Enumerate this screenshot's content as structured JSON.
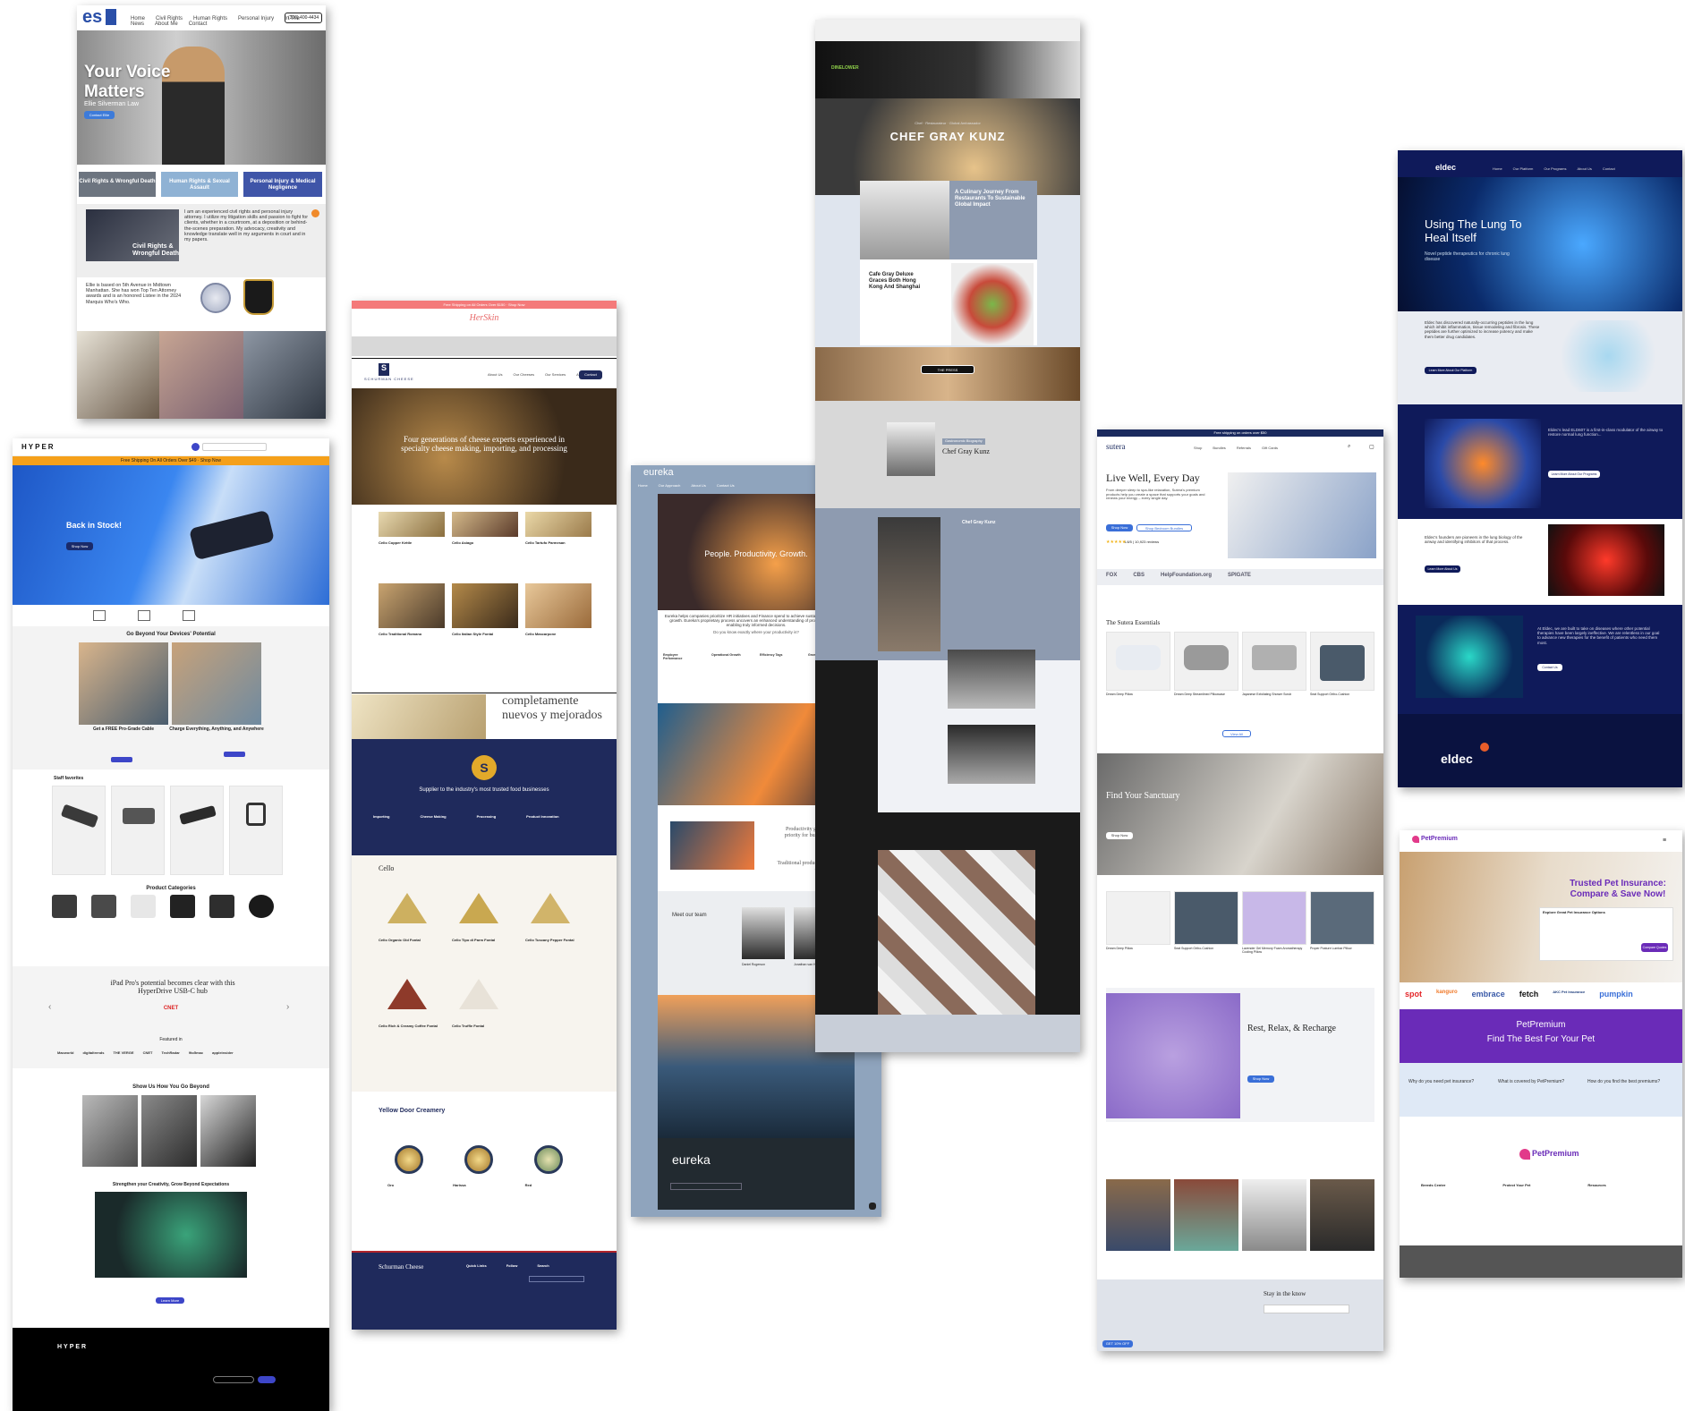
{
  "ellie": {
    "logo": "es",
    "nav": [
      "Home",
      "Civil Rights",
      "Human Rights",
      "Personal Injury",
      "In The News",
      "About Me",
      "Contact"
    ],
    "phone": "(310) 400-4434",
    "hero_title": "Your Voice Matters",
    "hero_sub": "Ellie Silverman Law",
    "hero_cta": "Contact Ellie",
    "tiles": [
      "Civil Rights & Wrongful Death",
      "Human Rights & Sexual Assault",
      "Personal Injury & Medical Negligence"
    ],
    "about_text": "I am an experienced civil rights and personal injury attorney. I utilize my litigation skills and passion to fight for clients, whether in a courtroom, at a deposition or behind-the-scenes preparation. My advocacy, creativity and knowledge translate well in my arguments in court and in my papers.",
    "inset_label": "Civil Rights & Wrongful Death",
    "bio_text": "Ellie is based on 5th Avenue in Midtown Manhattan. She has won Top Ten Attorney awards and is an honored Listee in the 2024 Marquis Who's Who.",
    "colors": {
      "tile1": "#6d7580",
      "tile2": "#8fb2d4",
      "tile3": "#3f55a8"
    }
  },
  "hyper": {
    "logo": "HYPER",
    "banner": "Free Shipping On All Orders Over $49 · Shop Now",
    "hero_title": "Back in Stock!",
    "hero_cta": "Shop Now",
    "section1_title": "Go Beyond Your Devices' Potential",
    "promo1": "Get a FREE Pro-Grade Cable",
    "promo2": "Charge Everything, Anything, and Anywhere",
    "best_sellers": "Staff favorites",
    "categories_title": "Product Categories",
    "categories": [
      "iPad",
      "HyperDrive USB-C Hubs",
      "HyperJuice Power",
      "Accessories",
      "Cables",
      "Bundles"
    ],
    "quote": "iPad Pro's potential becomes clear with this HyperDrive USB-C hub",
    "quote_source": "CNET",
    "featured": "Featured in",
    "press": [
      "Macworld",
      "digitaltrends",
      "THE VERGE",
      "CNET",
      "TechRadar",
      "9to5mac",
      "appleinsider"
    ],
    "show_us": "Show Us How You Go Beyond",
    "strengthen": "Strengthen your Creativity, Grow Beyond Expectations",
    "strengthen_cta": "Learn More",
    "footer_logo": "HYPER",
    "colors": {
      "banner": "#f5a01a",
      "accent": "#3d46c8"
    }
  },
  "cheese": {
    "promo_bar": "Free Shipping on All Orders Over $150 · Shop Now",
    "herskin": "HerSkin",
    "logo": "SCHURMAN CHEESE",
    "nav": [
      "About Us",
      "Our Cheeses",
      "Our Services",
      "About Us",
      "Contact"
    ],
    "nav_cta": "Contact",
    "hero_title": "Four generations of cheese experts experienced in specialty cheese making, importing, and processing",
    "products_row1": [
      "Cello Copper Kettle",
      "Cello Asiago",
      "Cello Tartufo Parmesan"
    ],
    "products_row2": [
      "Cello Traditional Romano",
      "Cello Italian Style Fontal",
      "Cello Mascarpone"
    ],
    "spanish": "completamente nuevos y mejorados",
    "supplier_title": "Supplier to the industry's most trusted food businesses",
    "services": [
      "Importing",
      "Cheese Making",
      "Processing",
      "Product Innovation"
    ],
    "cello_label": "Cello",
    "wedges": [
      "Cello Organic Old Fontal",
      "Cello Tipo di Parm Fontal",
      "Cello Tuscany Pepper Fontal",
      "Cello Rich & Creamy Coffee Fontal",
      "Cello Truffle Fontal"
    ],
    "yellow_door": "Yellow Door Creamery",
    "rounds": [
      "Oro",
      "Harissa",
      "Red"
    ],
    "footer_title": "Schurman Cheese",
    "footer_cols": [
      "Quick Links",
      "Follow",
      "Search"
    ],
    "colors": {
      "navy": "#1f2a5c",
      "promo": "#f47a7a"
    }
  },
  "eureka": {
    "logo": "eureka",
    "nav": [
      "Home",
      "Our Approach",
      "About Us",
      "Contact Us"
    ],
    "cta": "Book a Demo",
    "hero_title": "People. Productivity. Growth.",
    "intro": "Eureka helps companies prioritize HR initiatives and Finance spend to achieve sustainable productivity growth. Eureka's proprietary process uncovers an enhanced understanding of productivity levers, enabling truly informed decisions.",
    "question": "Do you know exactly where your productivity is?",
    "pillars": [
      "Employee Performance",
      "Operational Growth",
      "Efficiency Tags",
      "Growth"
    ],
    "quote1": "Productivity growth is a top priority for business leaders.",
    "quote2": "Traditional productivity metrics do not capture",
    "team_title": "Meet our team",
    "team": [
      "Daniel Rogerson",
      "Jonathan van Hart"
    ],
    "footer_logo": "eureka",
    "colors": {
      "frame": "#8fa4bd",
      "dark": "#222a30"
    }
  },
  "chef": {
    "brand": "DINELOWER",
    "eyebrow": "Chef · Restaurateur · Global Ambassador",
    "hero_title": "CHEF GRAY KUNZ",
    "story_title": "A Culinary Journey From Restaurants To Sustainable Global Impact",
    "cafe_title": "Cafe Gray Deluxe Graces Both Hong Kong And Shanghai",
    "press_btn": "THE PRESS",
    "badge": "Gastronomic Biography",
    "name2": "Chef Gray Kunz",
    "section_title": "Chef Gray Kunz",
    "colors": {
      "slate": "#8e9bb0",
      "dark": "#1a1a1a"
    }
  },
  "sutera": {
    "logo": "sutera",
    "topbar": "Free shipping on orders over $50",
    "nav": [
      "Shop",
      "Bundles",
      "Referrals",
      "Gift Cards"
    ],
    "hero_title": "Live Well, Every Day",
    "hero_text": "From deeper sleep to spa-like relaxation, Sutera's premium products help you create a space that supports your goals and renews your energy – every single day.",
    "cta1": "Shop Now",
    "cta2": "Shop Bedroom Bundles",
    "rating": "4.8/5 | 10,923 reviews",
    "logos": [
      "FOX",
      "CBS",
      "HelpFoundation.org",
      "SPIGATE"
    ],
    "essentials": "The Sutera Essentials",
    "products": [
      "Dream Deep Pillow",
      "Dream Deep Streamlined Pillowcase",
      "Japanese Exfoliating Shower Scrub",
      "Seat Support Ortho-Cushion"
    ],
    "badge": "Save 40%",
    "view_all": "View All",
    "sanctuary_title": "Find Your Sanctuary",
    "sanctuary_cta": "Shop Now",
    "products2": [
      "Dream Deep Pillow",
      "Seat Support Ortho-Cushion",
      "Lavender Gel Memory Foam Aromatherapy Cooling Pillow",
      "Proper Posture Lumbar Pillow"
    ],
    "rest_title": "Rest, Relax, & Recharge",
    "rest_cta": "Shop Now",
    "stay": "Stay in the know",
    "email_ph": "Enter your email",
    "footer_cta": "GET 10% OFF",
    "colors": {
      "navy": "#1b2a5e",
      "blue": "#3a6fd8"
    }
  },
  "eldec": {
    "logo": "eldec",
    "nav": [
      "Home",
      "Our Platform",
      "Our Programs",
      "About Us",
      "Contact"
    ],
    "hero_title": "Using The Lung To Heal Itself",
    "hero_sub": "Novel peptide therapeutics for chronic lung disease",
    "text1": "Eldec has discovered naturally-occurring peptides in the lung which inhibit inflammation, tissue remodeling and fibrosis. These peptides are further optimized to increase potency and make them better drug candidates.",
    "cta1": "Learn More About Our Platform",
    "text2": "Eldec's lead ELD607 is a first-in-class modulator of the airway to restore normal lung function...",
    "cta2": "Learn More About Our Programs",
    "text3": "Eldec's founders are pioneers in the lung biology of the airway and identifying inhibitors of that process.",
    "cta3": "Learn More About Us",
    "text4": "At Eldec, we are built to take on diseases where other potential therapies have been largely ineffective. We are relentless in our goal to advance new therapies for the benefit of patients who need them most.",
    "cta4": "Contact Us",
    "footer_logo": "eldec",
    "colors": {
      "navy": "#0f1a5a",
      "accent": "#e85d2a"
    }
  },
  "petpremium": {
    "logo": "PetPremium",
    "hero_title": "Trusted Pet Insurance: Compare & Save Now!",
    "form_title": "Explore Great Pet Insurance Options",
    "form_cta": "Compare Quotes",
    "partners": [
      "spot",
      "kanguro",
      "embrace",
      "fetch",
      "AKC Pet Insurance",
      "pumpkin"
    ],
    "band_title": "PetPremium",
    "band_sub": "Find The Best For Your Pet",
    "faqs": [
      "Why do you need pet insurance?",
      "What is covered by PetPremium?",
      "How do you find the best premiums?"
    ],
    "footer_logo": "PetPremium",
    "footer_cols": [
      "Breeds Center",
      "Protect Your Pet",
      "Resources"
    ],
    "colors": {
      "purple": "#6a2bb8",
      "pink": "#e23a8a"
    }
  }
}
